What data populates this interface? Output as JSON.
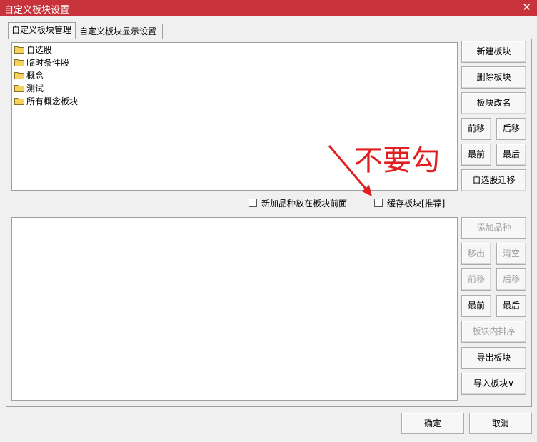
{
  "window": {
    "title": "自定义板块设置",
    "close": "✕"
  },
  "tabs": [
    {
      "label": "自定义板块管理"
    },
    {
      "label": "自定义板块显示设置"
    }
  ],
  "block_list": [
    {
      "label": "自选股"
    },
    {
      "label": "临时条件股"
    },
    {
      "label": "概念"
    },
    {
      "label": "测试"
    },
    {
      "label": "所有概念板块"
    }
  ],
  "block_buttons": {
    "new": "新建板块",
    "delete": "删除板块",
    "rename": "板块改名",
    "move_up": "前移",
    "move_down": "后移",
    "move_first": "最前",
    "move_last": "最后",
    "migrate": "自选股迁移"
  },
  "options": {
    "add_front": "新加品种放在板块前面",
    "cache": "缓存板块[推荐]"
  },
  "annotation": {
    "text": "不要勾",
    "color": "#e02020"
  },
  "stock_buttons": {
    "add": "添加品种",
    "remove": "移出",
    "clear": "清空",
    "move_up": "前移",
    "move_down": "后移",
    "move_first": "最前",
    "move_last": "最后",
    "sort": "板块内排序",
    "export": "导出板块",
    "import": "导入板块∨"
  },
  "footer": {
    "ok": "确定",
    "cancel": "取消"
  },
  "colors": {
    "titlebar": "#c8323a",
    "folder": "#f5d35a"
  }
}
